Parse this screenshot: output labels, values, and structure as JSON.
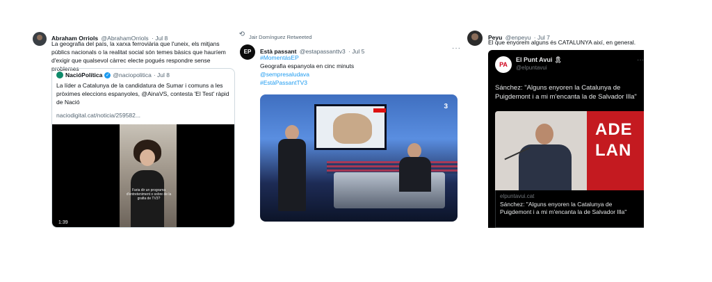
{
  "tweet1": {
    "author_name": "Abraham Orriols",
    "author_handle": "@AbrahamOrriols",
    "date": "· Jul 8",
    "text": "La geografia del país, la xarxa ferroviària que l'uneix, els mitjans públics nacionals o la realitat social són temes bàsics que hauríem d'exigir que qualsevol càrrec electe pogués respondre sense problemes",
    "quote": {
      "author_name": "NacióPolítica",
      "author_handle": "@naciopolitica",
      "date": "· Jul 8",
      "text": "La líder a Catalunya de la candidatura de Sumar i comuns a les pròximes eleccions espanyoles, @AinaVS, contesta 'El Test' ràpid de Nació",
      "link": "naciodigital.cat/noticia/259582...",
      "video_caption": "Faria dir un programa d'entreteniment o sobre de la grafia de TV3?",
      "video_duration": "1:39"
    }
  },
  "tweet2": {
    "retweet_label": "Jair Domínguez Retweeted",
    "author_name": "Està passant",
    "author_handle": "@estapassanttv3",
    "date": "· Jul 5",
    "avatar_text": "EP",
    "hashtag1": "#MomentásEP",
    "text": "Geografia espanyola en cinc minuts",
    "mention": "@sempresaludava",
    "hashtag2": "#EstàPassantTV3",
    "more_icon": "···",
    "retweet_icon": "⟲",
    "tv_logo": "3"
  },
  "tweet3": {
    "author_name": "Peyu",
    "author_handle": "@enpeyu",
    "date": "· Jul 7",
    "text": "El que enyorem alguns és CATALUNYA així, en general.",
    "card": {
      "source_name": "El Punt Avui",
      "ribbon": "🎗",
      "source_handle": "@elpuntavui",
      "logo_text": "PA",
      "headline": "Sánchez: \"Alguns enyoren la Catalunya de Puigdemont i a mi m'encanta la de Salvador Illa\"",
      "wall_text_1": "ADE",
      "wall_text_2": "LAN",
      "domain": "elpuntavui.cat",
      "link_title": "Sánchez: \"Alguns enyoren la Catalunya de Puigdemont i a mi m'encanta la de Salvador Illa\"",
      "more_icon": "···"
    }
  }
}
